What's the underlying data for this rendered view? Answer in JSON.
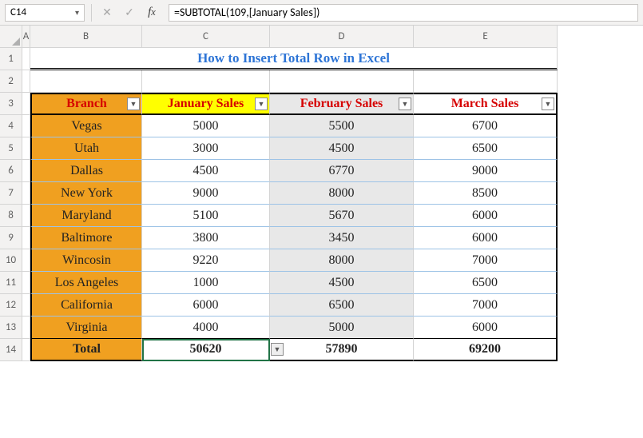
{
  "name_box": "C14",
  "formula": "=SUBTOTAL(109,[January Sales])",
  "col_headers": [
    "A",
    "B",
    "C",
    "D",
    "E"
  ],
  "row_headers": [
    "1",
    "2",
    "3",
    "4",
    "5",
    "6",
    "7",
    "8",
    "9",
    "10",
    "11",
    "12",
    "13",
    "14"
  ],
  "title": "How to Insert Total Row in Excel",
  "table": {
    "headers": [
      "Branch",
      "January Sales",
      "February Sales",
      "March Sales"
    ],
    "rows": [
      {
        "branch": "Vegas",
        "jan": "5000",
        "feb": "5500",
        "mar": "6700"
      },
      {
        "branch": "Utah",
        "jan": "3000",
        "feb": "4500",
        "mar": "6500"
      },
      {
        "branch": "Dallas",
        "jan": "4500",
        "feb": "6770",
        "mar": "9000"
      },
      {
        "branch": "New York",
        "jan": "9000",
        "feb": "8000",
        "mar": "8500"
      },
      {
        "branch": "Maryland",
        "jan": "5100",
        "feb": "5670",
        "mar": "6000"
      },
      {
        "branch": "Baltimore",
        "jan": "3800",
        "feb": "3450",
        "mar": "6000"
      },
      {
        "branch": "Wincosin",
        "jan": "9220",
        "feb": "8000",
        "mar": "7000"
      },
      {
        "branch": "Los Angeles",
        "jan": "1000",
        "feb": "4500",
        "mar": "6500"
      },
      {
        "branch": "California",
        "jan": "6000",
        "feb": "6500",
        "mar": "7000"
      },
      {
        "branch": "Virginia",
        "jan": "4000",
        "feb": "5000",
        "mar": "6000"
      }
    ],
    "total": {
      "label": "Total",
      "jan": "50620",
      "feb": "57890",
      "mar": "69200"
    }
  },
  "chart_data": {
    "type": "table",
    "title": "How to Insert Total Row in Excel",
    "columns": [
      "Branch",
      "January Sales",
      "February Sales",
      "March Sales"
    ],
    "data": [
      [
        "Vegas",
        5000,
        5500,
        6700
      ],
      [
        "Utah",
        3000,
        4500,
        6500
      ],
      [
        "Dallas",
        4500,
        6770,
        9000
      ],
      [
        "New York",
        9000,
        8000,
        8500
      ],
      [
        "Maryland",
        5100,
        5670,
        6000
      ],
      [
        "Baltimore",
        3800,
        3450,
        6000
      ],
      [
        "Wincosin",
        9220,
        8000,
        7000
      ],
      [
        "Los Angeles",
        1000,
        4500,
        6500
      ],
      [
        "California",
        6000,
        6500,
        7000
      ],
      [
        "Virginia",
        4000,
        5000,
        6000
      ]
    ],
    "totals": {
      "January Sales": 50620,
      "February Sales": 57890,
      "March Sales": 69200
    },
    "selected_cell": "C14",
    "formula": "=SUBTOTAL(109,[January Sales])"
  }
}
